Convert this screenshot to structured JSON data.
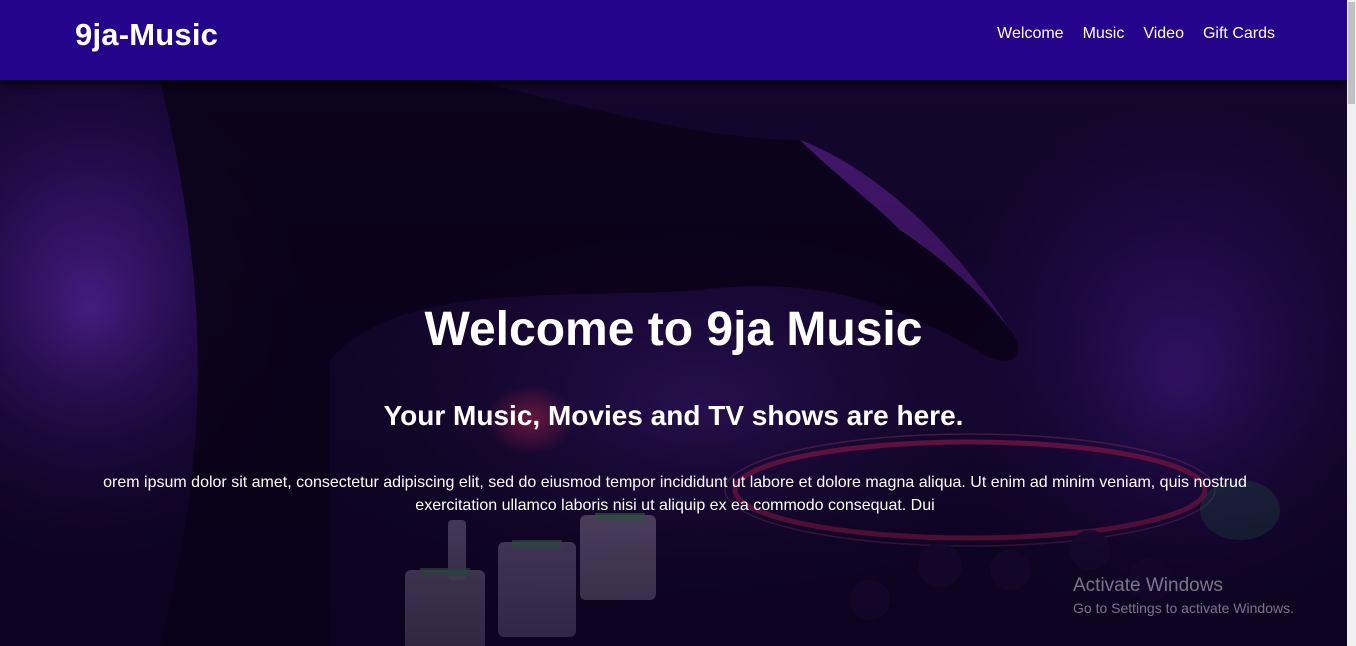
{
  "navbar": {
    "brand": "9ja-Music",
    "links": [
      "Welcome",
      "Music",
      "Video",
      "Gift Cards"
    ]
  },
  "hero": {
    "title": "Welcome to 9ja Music",
    "subtitle": "Your Music, Movies and TV shows are here.",
    "text": "orem ipsum dolor sit amet, consectetur adipiscing elit, sed do eiusmod tempor incididunt ut labore et dolore magna aliqua. Ut enim ad minim veniam, quis nostrud exercitation ullamco laboris nisi ut aliquip ex ea commodo consequat. Dui"
  },
  "watermark": {
    "title": "Activate Windows",
    "subtitle": "Go to Settings to activate Windows."
  },
  "colors": {
    "navbar": "#24048a",
    "text": "#ffffff",
    "accent_purple": "#7a2ee0",
    "accent_pink": "#ff3a8a"
  }
}
